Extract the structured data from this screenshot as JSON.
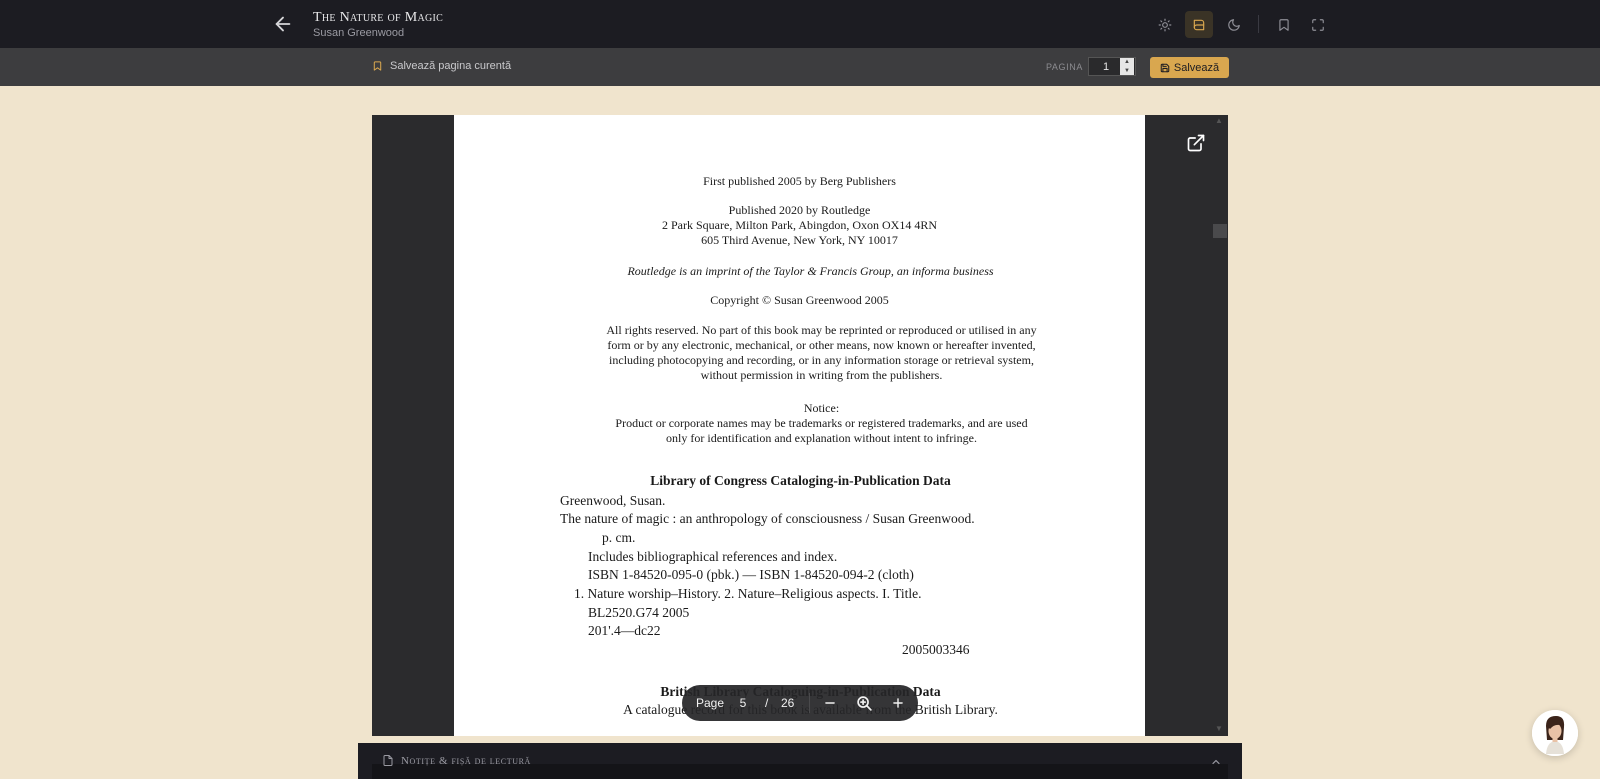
{
  "header": {
    "title": "The Nature of Magic",
    "author": "Susan Greenwood",
    "icons": [
      "arrow-left-icon",
      "sun-icon",
      "book-icon",
      "moon-icon",
      "bookmark-icon",
      "fullscreen-icon"
    ]
  },
  "subbar": {
    "save_current": "Salvează pagina curentă",
    "page_label": "PAGINA",
    "page_value": "1",
    "save_button": "Salvează"
  },
  "pdf_page": {
    "lines": [
      "First published 2005 by Berg Publishers",
      "Published 2020 by Routledge",
      "2 Park Square, Milton Park, Abingdon, Oxon OX14 4RN",
      "605 Third Avenue, New York, NY 10017",
      "Routledge is an imprint of the Taylor & Francis Group, an informa business",
      "Copyright © Susan Greenwood 2005",
      "All rights reserved. No part of this book may be reprinted or reproduced or utilised in any",
      "form or by any electronic, mechanical, or other means, now known or hereafter invented,",
      "including photocopying and recording, or in any information storage or retrieval system,",
      "without permission in writing from the publishers.",
      "Notice:",
      "Product or corporate names may be trademarks or registered trademarks, and are used",
      "only for identification and explanation without intent to infringe.",
      "Library of Congress Cataloging-in-Publication Data",
      "Greenwood, Susan.",
      "The nature of magic : an anthropology of consciousness / Susan Greenwood.",
      "p. cm.",
      "Includes bibliographical references and index.",
      "ISBN 1-84520-095-0 (pbk.) — ISBN 1-84520-094-2 (cloth)",
      "1. Nature worship–History. 2. Nature–Religious aspects. I. Title.",
      "BL2520.G74 2005",
      "201'.4—dc22",
      "2005003346",
      "British Library Cataloguing-in-Publication Data",
      "A catalogue record for this book is available from the British Library."
    ]
  },
  "page_toolbar": {
    "label": "Page",
    "current": "5",
    "separator": "/",
    "total": "26"
  },
  "notes": {
    "title": "Notițe & fișă de lectură"
  },
  "colors": {
    "topbar": "#1c1c22",
    "subbar": "#3d3d3f",
    "background": "#f0e4cd",
    "accent": "#d9a74f"
  }
}
